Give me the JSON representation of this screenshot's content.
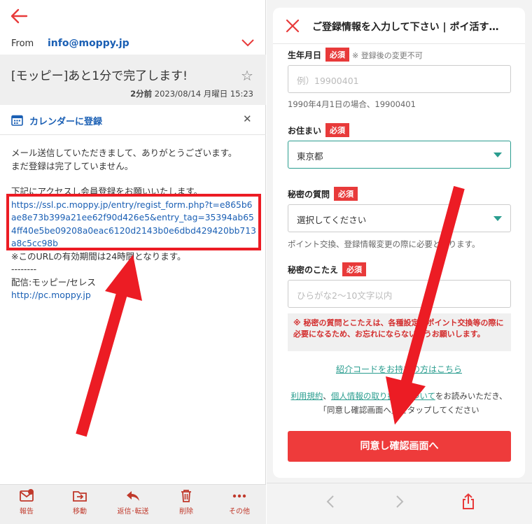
{
  "mail": {
    "from_label": "From",
    "from_address": "info@moppy.jp",
    "subject": "[モッピー]あと1分で完了します!",
    "date_relative": "2分前",
    "date_full": "2023/08/14 月曜日 15:23",
    "calendar_label": "カレンダーに登録",
    "body_line1": "メール送信していただきまして、ありがとうございます。",
    "body_line2": "まだ登録は完了していません。",
    "body_line3": "下記にアクセスし会員登録をお願いいたします。",
    "url": "https://ssl.pc.moppy.jp/entry/regist_form.php?t=e865b6ae8e73b399a21ee62f90d426e5&entry_tag=35394ab654ff40e5be09208a0eac6120d2143b0e6dbd429420bb713a8c5cc98b",
    "expiry_note": "※このURLの有効期間は24時間となります。",
    "divider": "--------",
    "sender": "配信:モッピー/セレス",
    "site_link": "http://pc.moppy.jp",
    "toolbar": [
      {
        "label": "報告",
        "icon": "report-icon"
      },
      {
        "label": "移動",
        "icon": "move-icon"
      },
      {
        "label": "返信･転送",
        "icon": "reply-icon"
      },
      {
        "label": "削除",
        "icon": "trash-icon"
      },
      {
        "label": "その他",
        "icon": "more-icon"
      }
    ]
  },
  "form": {
    "title": "ご登録情報を入力して下さい | ポイ活す…",
    "required_badge": "必須",
    "birth_label": "生年月日",
    "birth_note": "※ 登録後の変更不可",
    "birth_placeholder": "例）19900401",
    "birth_hint": "1990年4月1日の場合、19900401",
    "address_label": "お住まい",
    "address_value": "東京都",
    "question_label": "秘密の質問",
    "question_placeholder": "選択してください",
    "question_hint": "ポイント交換、登録情報変更の際に必要となります。",
    "answer_label": "秘密のこたえ",
    "answer_placeholder": "ひらがな2〜10文字以内",
    "warning": "※ 秘密の質問とこたえは、各種設定・ポイント交換等の際に必要になるため、お忘れにならないようお願いします。",
    "referral_link": "紹介コードをお持ちの方はこちら",
    "terms_link1": "利用規約",
    "terms_sep": "、",
    "terms_link2": "個人情報の取り扱いについて",
    "terms_rest": "をお読みいただき、「同意し確認画面へ」をタップしてください",
    "submit_label": "同意し確認画面へ"
  },
  "colors": {
    "highlight_red": "#ec1c24",
    "link_blue": "#1a5fb4",
    "accent_teal": "#2a9d8f",
    "submit_red": "#ee3b3b"
  }
}
